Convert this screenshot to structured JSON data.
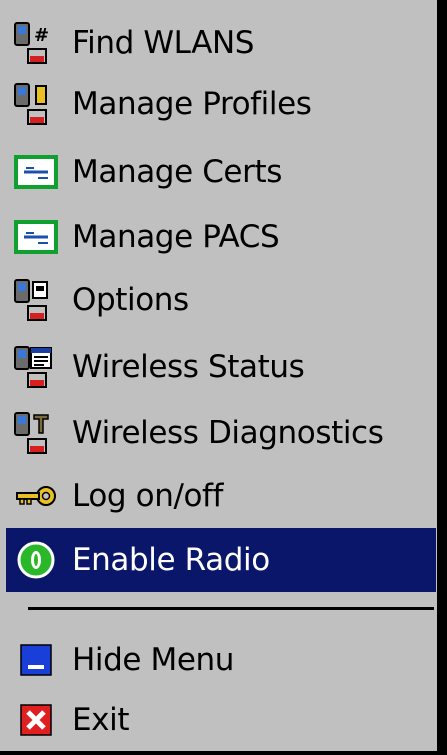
{
  "menu": {
    "items": [
      {
        "label": "Find WLANS",
        "icon": "find-wlans-icon"
      },
      {
        "label": "Manage Profiles",
        "icon": "manage-profiles-icon"
      },
      {
        "label": "Manage Certs",
        "icon": "certificate-icon"
      },
      {
        "label": "Manage PACS",
        "icon": "certificate-icon"
      },
      {
        "label": "Options",
        "icon": "options-icon"
      },
      {
        "label": "Wireless Status",
        "icon": "wireless-status-icon"
      },
      {
        "label": "Wireless Diagnostics",
        "icon": "wireless-diagnostics-icon"
      },
      {
        "label": "Log on/off",
        "icon": "key-icon"
      },
      {
        "label": "Enable Radio",
        "icon": "enable-radio-icon",
        "selected": true
      }
    ],
    "bottom_items": [
      {
        "label": "Hide Menu",
        "icon": "hide-menu-icon"
      },
      {
        "label": "Exit",
        "icon": "exit-icon"
      }
    ]
  },
  "colors": {
    "menu_background": "#c0c0c0",
    "selected_background": "#0a166a",
    "selected_text": "#ffffff",
    "text": "#000000"
  }
}
